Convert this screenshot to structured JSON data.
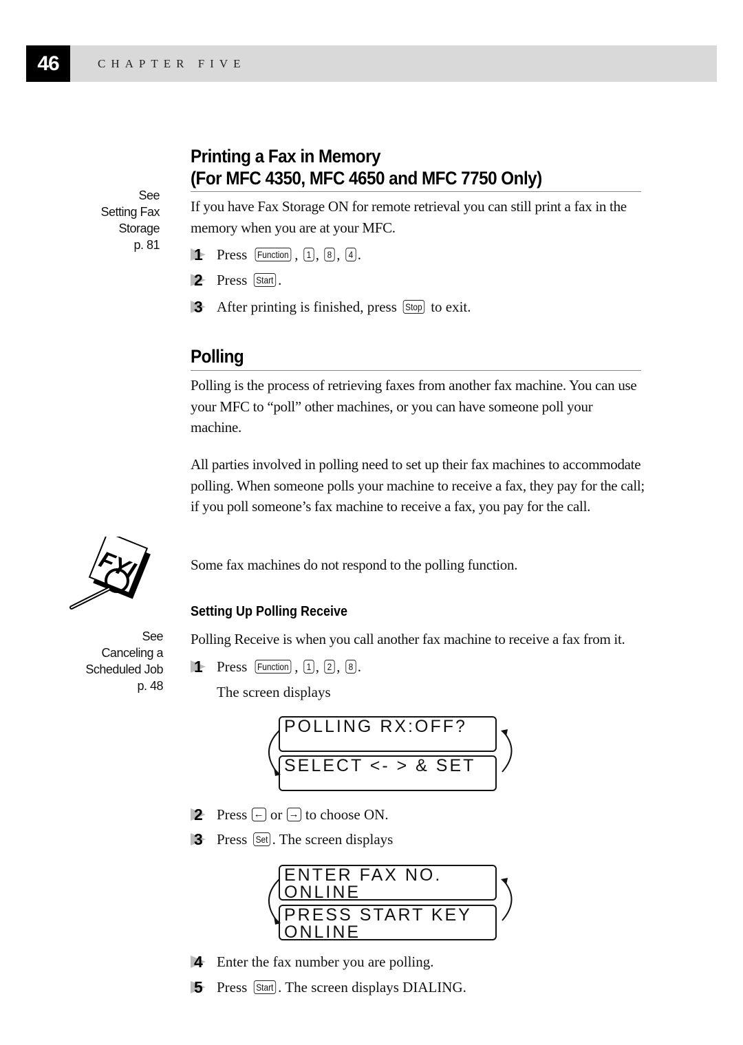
{
  "header": {
    "page_number": "46",
    "chapter": "CHAPTER FIVE"
  },
  "margin_notes": [
    {
      "lines": [
        "See",
        "Setting Fax",
        "Storage",
        "p. 81"
      ]
    },
    {
      "lines": [
        "See",
        "Canceling a",
        "Scheduled Job",
        "p. 48"
      ]
    }
  ],
  "icons": {
    "fyi": "fyi-magnifier-icon"
  },
  "section1": {
    "title_line1": "Printing a Fax in Memory",
    "title_line2": "(For MFC 4350, MFC 4650 and MFC 7750 Only)",
    "intro": "If you have Fax Storage ON for remote retrieval you can still print a fax in the memory when you are at your MFC.",
    "steps": [
      {
        "num": "1",
        "pre": "Press ",
        "keys": [
          "Function",
          "1",
          "8",
          "4"
        ],
        "post": "."
      },
      {
        "num": "2",
        "pre": "Press ",
        "keys": [
          "Start"
        ],
        "post": "."
      },
      {
        "num": "3",
        "pre": "After printing is finished, press ",
        "keys": [
          "Stop"
        ],
        "post": " to exit."
      }
    ]
  },
  "section2": {
    "title": "Polling",
    "para1": "Polling is the process of retrieving faxes from another fax machine.  You can use your MFC to “poll” other machines, or you can have someone poll your machine.",
    "para2": "All parties involved in polling need to set up their fax machines to accommodate polling.  When someone polls your machine to receive a fax, they pay for the call; if you poll someone’s fax machine to receive a fax, you pay for the call.",
    "note": "Some fax machines do not respond to the polling function.",
    "subsection": {
      "title": "Setting Up Polling Receive",
      "intro": "Polling Receive is when you call another fax machine to receive a fax from it.",
      "step1": {
        "num": "1",
        "pre": "Press ",
        "keys": [
          "Function",
          "1",
          "2",
          "8"
        ],
        "post": ".",
        "sub": "The screen displays"
      },
      "lcd1": [
        "POLLING RX:OFF?",
        "SELECT <- > & SET"
      ],
      "step2": {
        "num": "2",
        "pre": "Press ",
        "left_key": "←",
        "mid": " or ",
        "right_key": "→",
        "post": " to choose ON."
      },
      "step3": {
        "num": "3",
        "pre": "Press ",
        "key": "Set",
        "post": ". The screen displays"
      },
      "lcd2": [
        {
          "line1": "ENTER FAX NO.",
          "line2": "ONLINE"
        },
        {
          "line1": "PRESS START KEY",
          "line2": "ONLINE"
        }
      ],
      "step4": {
        "num": "4",
        "text": "Enter the fax number you are polling."
      },
      "step5": {
        "num": "5",
        "pre": "Press ",
        "key": "Start",
        "post": ". The screen displays DIALING."
      }
    }
  }
}
